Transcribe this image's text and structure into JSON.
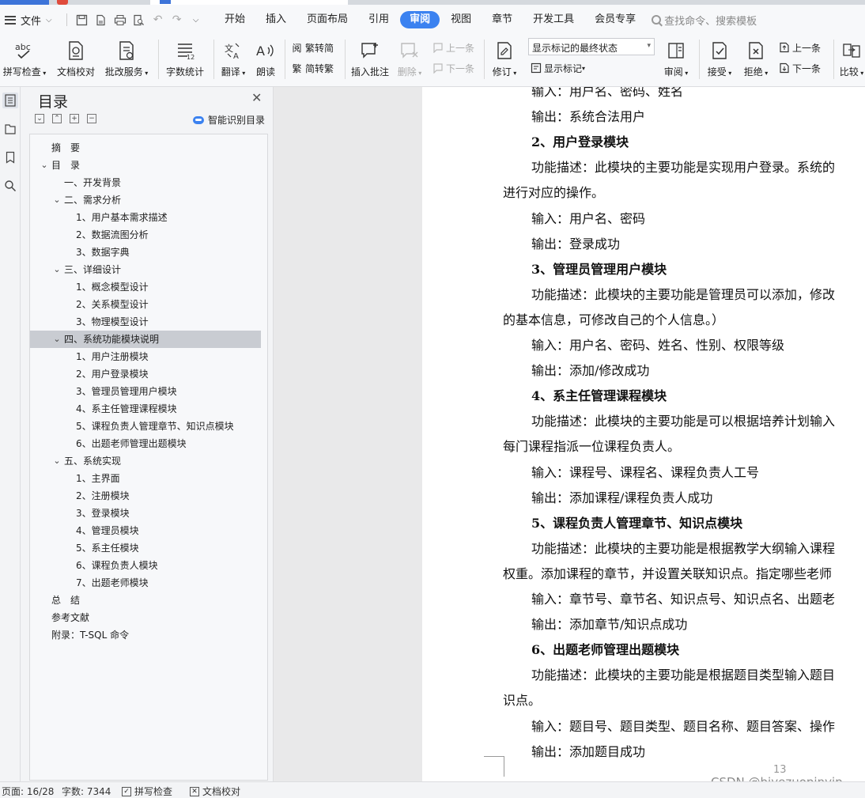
{
  "menubar": {
    "file_label": "文件",
    "tabs": [
      "开始",
      "插入",
      "页面布局",
      "引用",
      "审阅",
      "视图",
      "章节",
      "开发工具",
      "会员专享"
    ],
    "active_tab": "审阅",
    "search_placeholder": "查找命令、搜索模板"
  },
  "ribbon": {
    "spell_check": "拼写检查",
    "doc_proof": "文档校对",
    "grading_service": "批改服务",
    "word_count": "字数统计",
    "translate": "翻译",
    "read_aloud": "朗读",
    "trad_to_simp": "繁转简",
    "simp_to_trad": "简转繁",
    "insert_comment": "插入批注",
    "delete": "删除",
    "prev_comment": "上一条",
    "next_comment": "下一条",
    "track_changes": "修订",
    "markup_mode": "显示标记的最终状态",
    "show_markup": "显示标记",
    "review": "审阅",
    "accept": "接受",
    "reject": "拒绝",
    "prev_change": "上一条",
    "next_change": "下一条",
    "compare": "比较"
  },
  "toc": {
    "title": "目录",
    "smart_label": "智能识别目录",
    "items": [
      {
        "text": "摘　要",
        "level": 0,
        "chevron": ""
      },
      {
        "text": "目　录",
        "level": 0,
        "chevron": "⌄"
      },
      {
        "text": "一、开发背景",
        "level": 1,
        "chevron": ""
      },
      {
        "text": "二、需求分析",
        "level": 1,
        "chevron": "⌄"
      },
      {
        "text": "1、用户基本需求描述",
        "level": 2,
        "chevron": ""
      },
      {
        "text": "2、数据流图分析",
        "level": 2,
        "chevron": ""
      },
      {
        "text": "3、数据字典",
        "level": 2,
        "chevron": ""
      },
      {
        "text": "三、详细设计",
        "level": 1,
        "chevron": "⌄"
      },
      {
        "text": "1、概念模型设计",
        "level": 2,
        "chevron": ""
      },
      {
        "text": "2、关系模型设计",
        "level": 2,
        "chevron": ""
      },
      {
        "text": "3、物理模型设计",
        "level": 2,
        "chevron": ""
      },
      {
        "text": "四、系统功能模块说明",
        "level": 1,
        "chevron": "⌄",
        "selected": true
      },
      {
        "text": "1、用户注册模块",
        "level": 2,
        "chevron": ""
      },
      {
        "text": "2、用户登录模块",
        "level": 2,
        "chevron": ""
      },
      {
        "text": "3、管理员管理用户模块",
        "level": 2,
        "chevron": ""
      },
      {
        "text": "4、系主任管理课程模块",
        "level": 2,
        "chevron": ""
      },
      {
        "text": "5、课程负责人管理章节、知识点模块",
        "level": 2,
        "chevron": ""
      },
      {
        "text": "6、出题老师管理出题模块",
        "level": 2,
        "chevron": ""
      },
      {
        "text": "五、系统实现",
        "level": 1,
        "chevron": "⌄"
      },
      {
        "text": "1、主界面",
        "level": 2,
        "chevron": ""
      },
      {
        "text": "2、注册模块",
        "level": 2,
        "chevron": ""
      },
      {
        "text": "3、登录模块",
        "level": 2,
        "chevron": ""
      },
      {
        "text": "4、管理员模块",
        "level": 2,
        "chevron": ""
      },
      {
        "text": "5、系主任模块",
        "level": 2,
        "chevron": ""
      },
      {
        "text": "6、课程负责人模块",
        "level": 2,
        "chevron": ""
      },
      {
        "text": "7、出题老师模块",
        "level": 2,
        "chevron": ""
      },
      {
        "text": "总　结",
        "level": 0,
        "chevron": ""
      },
      {
        "text": "参考文献",
        "level": 0,
        "chevron": ""
      },
      {
        "text": "附录：T-SQL 命令",
        "level": 0,
        "chevron": ""
      }
    ]
  },
  "document": {
    "lines": [
      {
        "text": "输入：用户名、密码、姓名",
        "kind": "body"
      },
      {
        "text": "输出：系统合法用户",
        "kind": "body"
      },
      {
        "text": "2、用户登录模块",
        "kind": "heading"
      },
      {
        "text": "功能描述：此模块的主要功能是实现用户登录。系统的",
        "kind": "body"
      },
      {
        "text": "进行对应的操作。",
        "kind": "cont"
      },
      {
        "text": "输入：用户名、密码",
        "kind": "body"
      },
      {
        "text": "输出：登录成功",
        "kind": "body"
      },
      {
        "text": "3、管理员管理用户模块",
        "kind": "heading"
      },
      {
        "text": "功能描述：此模块的主要功能是管理员可以添加，修改",
        "kind": "body"
      },
      {
        "text": "的基本信息，可修改自己的个人信息。）",
        "kind": "cont"
      },
      {
        "text": "输入：用户名、密码、姓名、性别、权限等级",
        "kind": "body"
      },
      {
        "text": "输出：添加/修改成功",
        "kind": "body"
      },
      {
        "text": "4、系主任管理课程模块",
        "kind": "heading"
      },
      {
        "text": "功能描述：此模块的主要功能是可以根据培养计划输入",
        "kind": "body"
      },
      {
        "text": "每门课程指派一位课程负责人。",
        "kind": "cont"
      },
      {
        "text": "输入：课程号、课程名、课程负责人工号",
        "kind": "body"
      },
      {
        "text": "输出：添加课程/课程负责人成功",
        "kind": "body"
      },
      {
        "text": "5、课程负责人管理章节、知识点模块",
        "kind": "heading"
      },
      {
        "text": "功能描述：此模块的主要功能是根据教学大纲输入课程",
        "kind": "body"
      },
      {
        "text": "权重。添加课程的章节，并设置关联知识点。指定哪些老师",
        "kind": "cont"
      },
      {
        "text": "输入：章节号、章节名、知识点号、知识点名、出题老",
        "kind": "body"
      },
      {
        "text": "输出：添加章节/知识点成功",
        "kind": "body"
      },
      {
        "text": "6、出题老师管理出题模块",
        "kind": "heading"
      },
      {
        "text": "功能描述：此模块的主要功能是根据题目类型输入题目",
        "kind": "body"
      },
      {
        "text": "识点。",
        "kind": "cont"
      },
      {
        "text": "输入：题目号、题目类型、题目名称、题目答案、操作",
        "kind": "body"
      },
      {
        "text": "输出：添加题目成功",
        "kind": "body"
      }
    ],
    "page_number": "13",
    "watermark": "CSDN @biyezuopinvip"
  },
  "statusbar": {
    "page": "页面: 16/28",
    "words": "字数: 7344",
    "spell_check": "拼写检查",
    "doc_proof": "文档校对"
  },
  "colors": {
    "accent": "#3b82f0",
    "selected_row": "#c9ccd2"
  }
}
